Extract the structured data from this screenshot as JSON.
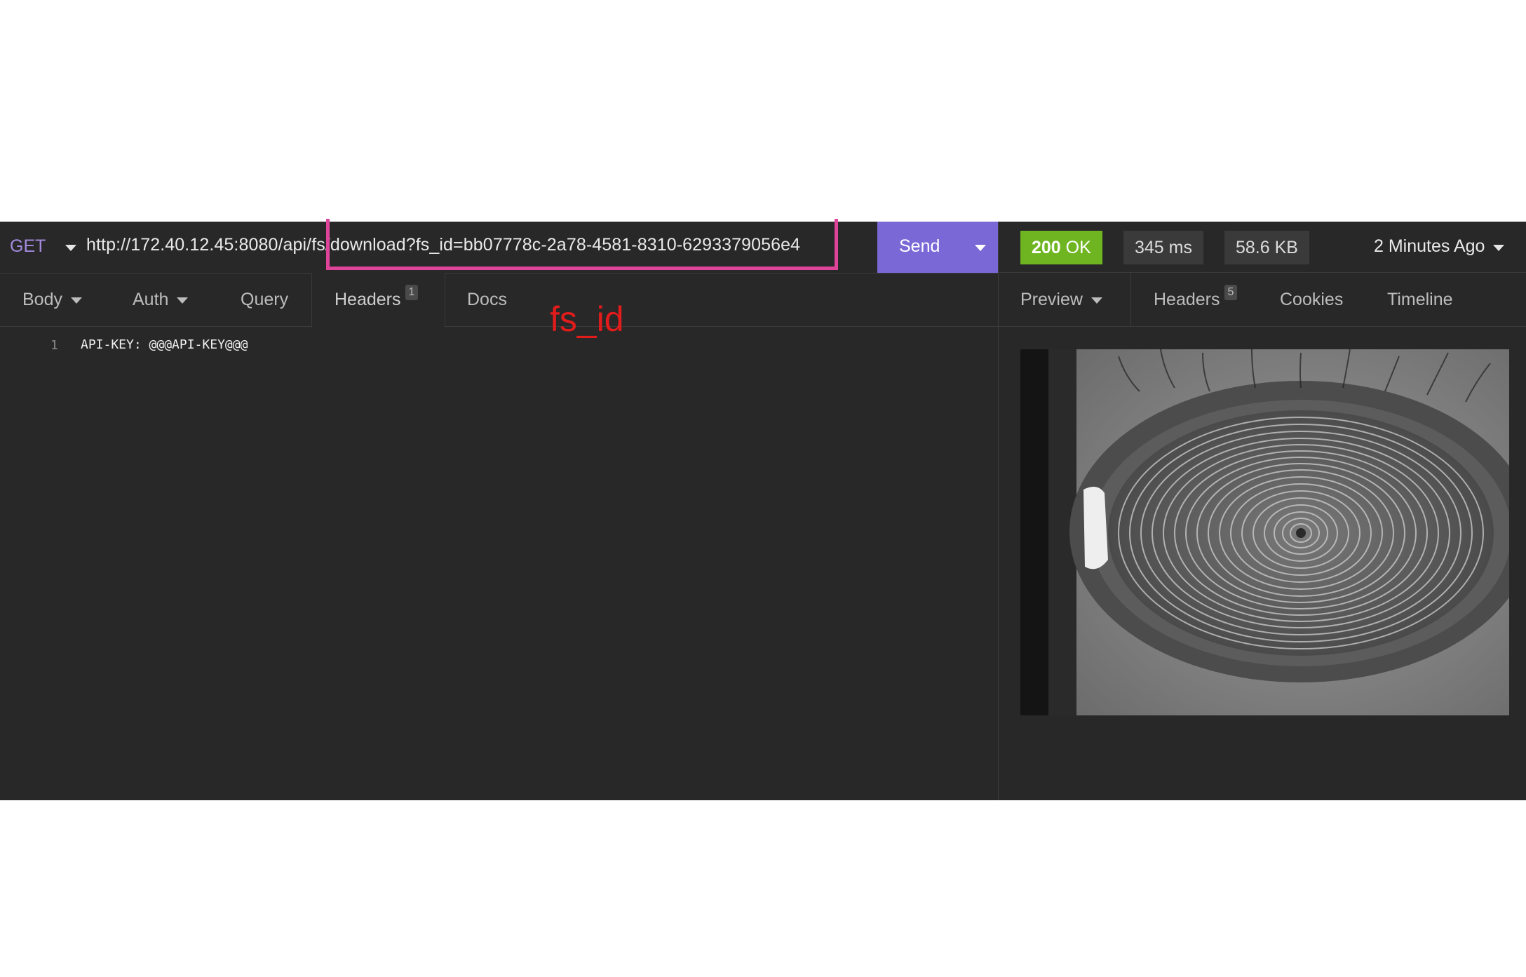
{
  "request": {
    "method": "GET",
    "url": "http://172.40.12.45:8080/api/fs/download?fs_id=bb07778c-2a78-4581-8310-6293379056e4",
    "send_label": "Send"
  },
  "response_meta": {
    "status_code": "200",
    "status_text": "OK",
    "time": "345 ms",
    "size": "58.6 KB",
    "when": "2 Minutes Ago"
  },
  "request_tabs": [
    {
      "label": "Body"
    },
    {
      "label": "Auth"
    },
    {
      "label": "Query"
    },
    {
      "label": "Headers",
      "badge": "1"
    },
    {
      "label": "Docs"
    }
  ],
  "response_tabs": [
    {
      "label": "Preview"
    },
    {
      "label": "Headers",
      "badge": "5"
    },
    {
      "label": "Cookies"
    },
    {
      "label": "Timeline"
    }
  ],
  "annotation": "fs_id",
  "editor": {
    "lines": [
      {
        "num": "1",
        "text": "API-KEY: @@@API-KEY@@@"
      }
    ]
  },
  "colors": {
    "accent": "#7a68d6",
    "status_ok": "#6fb522",
    "highlight": "#e0449a",
    "annotation": "#e21b1b",
    "background": "#282828"
  }
}
